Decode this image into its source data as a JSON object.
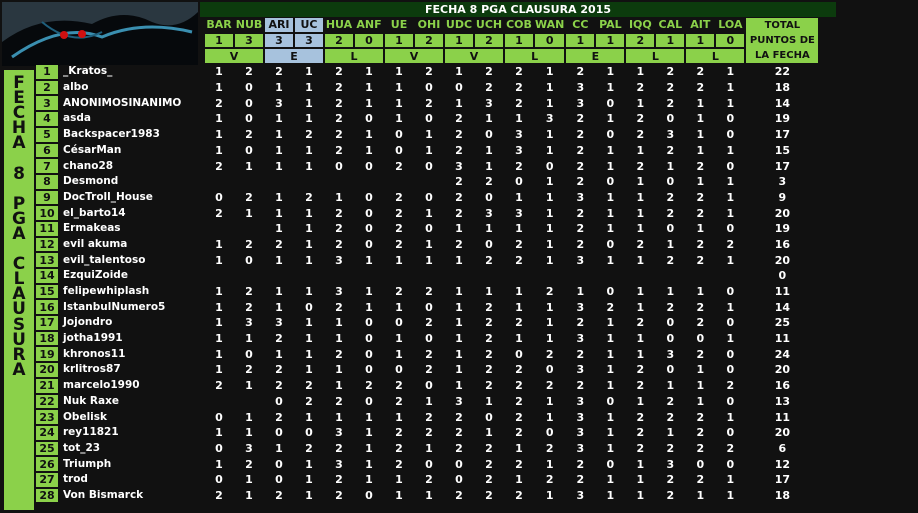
{
  "title": "FECHA 8 PGA CLAUSURA 2015",
  "side_label": [
    "F",
    "E",
    "C",
    "H",
    "A",
    "",
    "8",
    "",
    "P",
    "G",
    "A",
    "",
    "C",
    "L",
    "A",
    "U",
    "S",
    "U",
    "R",
    "A"
  ],
  "teams": [
    {
      "code": "BAR",
      "score": "1",
      "highlight": false
    },
    {
      "code": "NUB",
      "score": "3",
      "highlight": false
    },
    {
      "code": "ARI",
      "score": "3",
      "highlight": true
    },
    {
      "code": "UC",
      "score": "3",
      "highlight": true
    },
    {
      "code": "HUA",
      "score": "2",
      "highlight": false
    },
    {
      "code": "ANF",
      "score": "0",
      "highlight": false
    },
    {
      "code": "UE",
      "score": "1",
      "highlight": false
    },
    {
      "code": "OHI",
      "score": "2",
      "highlight": false
    },
    {
      "code": "UDC",
      "score": "1",
      "highlight": false
    },
    {
      "code": "UCH",
      "score": "2",
      "highlight": false
    },
    {
      "code": "COB",
      "score": "1",
      "highlight": false
    },
    {
      "code": "WAN",
      "score": "0",
      "highlight": false
    },
    {
      "code": "CC",
      "score": "1",
      "highlight": false
    },
    {
      "code": "PAL",
      "score": "1",
      "highlight": false
    },
    {
      "code": "IQQ",
      "score": "2",
      "highlight": false
    },
    {
      "code": "CAL",
      "score": "1",
      "highlight": false
    },
    {
      "code": "AIT",
      "score": "1",
      "highlight": false
    },
    {
      "code": "LOA",
      "score": "0",
      "highlight": false
    }
  ],
  "outcomes": [
    {
      "label": "V",
      "highlight": false
    },
    {
      "label": "E",
      "highlight": true
    },
    {
      "label": "L",
      "highlight": false
    },
    {
      "label": "V",
      "highlight": false
    },
    {
      "label": "V",
      "highlight": false
    },
    {
      "label": "L",
      "highlight": false
    },
    {
      "label": "E",
      "highlight": false
    },
    {
      "label": "L",
      "highlight": false
    },
    {
      "label": "L",
      "highlight": false
    }
  ],
  "total_header": [
    "TOTAL",
    "PUNTOS DE",
    "LA FECHA"
  ],
  "rows": [
    {
      "n": "1",
      "name": "_Kratos_",
      "v": [
        "1",
        "2",
        "2",
        "1",
        "2",
        "1",
        "1",
        "2",
        "1",
        "2",
        "2",
        "1",
        "2",
        "1",
        "1",
        "2",
        "2",
        "1"
      ],
      "total": "22"
    },
    {
      "n": "2",
      "name": "albo",
      "v": [
        "1",
        "0",
        "1",
        "1",
        "2",
        "1",
        "1",
        "0",
        "0",
        "2",
        "2",
        "1",
        "3",
        "1",
        "2",
        "2",
        "2",
        "1"
      ],
      "total": "18"
    },
    {
      "n": "3",
      "name": "ANONIMOSINANIMO",
      "v": [
        "2",
        "0",
        "3",
        "1",
        "2",
        "1",
        "1",
        "2",
        "1",
        "3",
        "2",
        "1",
        "3",
        "0",
        "1",
        "2",
        "1",
        "1"
      ],
      "total": "14"
    },
    {
      "n": "4",
      "name": "asda",
      "v": [
        "1",
        "0",
        "1",
        "1",
        "2",
        "0",
        "1",
        "0",
        "2",
        "1",
        "1",
        "3",
        "2",
        "1",
        "2",
        "0",
        "1",
        "0"
      ],
      "total": "19"
    },
    {
      "n": "5",
      "name": "Backspacer1983",
      "v": [
        "1",
        "2",
        "1",
        "2",
        "2",
        "1",
        "0",
        "1",
        "2",
        "0",
        "3",
        "1",
        "2",
        "0",
        "2",
        "3",
        "1",
        "0"
      ],
      "total": "17"
    },
    {
      "n": "6",
      "name": "CésarMan",
      "v": [
        "1",
        "0",
        "1",
        "1",
        "2",
        "1",
        "0",
        "1",
        "2",
        "1",
        "3",
        "1",
        "2",
        "1",
        "1",
        "2",
        "1",
        "1"
      ],
      "total": "15"
    },
    {
      "n": "7",
      "name": "chano28",
      "v": [
        "2",
        "1",
        "1",
        "1",
        "0",
        "0",
        "2",
        "0",
        "3",
        "1",
        "2",
        "0",
        "2",
        "1",
        "2",
        "1",
        "2",
        "0"
      ],
      "total": "17"
    },
    {
      "n": "8",
      "name": "Desmond",
      "v": [
        "",
        "",
        "",
        "",
        "",
        "",
        "",
        "",
        "2",
        "2",
        "0",
        "1",
        "2",
        "0",
        "1",
        "0",
        "1",
        "1"
      ],
      "total": "3"
    },
    {
      "n": "9",
      "name": "DocTroll_House",
      "v": [
        "0",
        "2",
        "1",
        "2",
        "1",
        "0",
        "2",
        "0",
        "2",
        "0",
        "1",
        "1",
        "3",
        "1",
        "1",
        "2",
        "2",
        "1"
      ],
      "total": "9"
    },
    {
      "n": "10",
      "name": "el_barto14",
      "v": [
        "2",
        "1",
        "1",
        "1",
        "2",
        "0",
        "2",
        "1",
        "2",
        "3",
        "3",
        "1",
        "2",
        "1",
        "1",
        "2",
        "2",
        "1"
      ],
      "total": "20"
    },
    {
      "n": "11",
      "name": "Ermakeas",
      "v": [
        "",
        "",
        "1",
        "1",
        "2",
        "0",
        "2",
        "0",
        "1",
        "1",
        "1",
        "1",
        "2",
        "1",
        "1",
        "0",
        "1",
        "0"
      ],
      "total": "19"
    },
    {
      "n": "12",
      "name": "evil akuma",
      "v": [
        "1",
        "2",
        "2",
        "1",
        "2",
        "0",
        "2",
        "1",
        "2",
        "0",
        "2",
        "1",
        "2",
        "0",
        "2",
        "1",
        "2",
        "2"
      ],
      "total": "16"
    },
    {
      "n": "13",
      "name": "evil_talentoso",
      "v": [
        "1",
        "0",
        "1",
        "1",
        "3",
        "1",
        "1",
        "1",
        "1",
        "2",
        "2",
        "1",
        "3",
        "1",
        "1",
        "2",
        "2",
        "1"
      ],
      "total": "20"
    },
    {
      "n": "14",
      "name": "EzquiZoide",
      "v": [
        "",
        "",
        "",
        "",
        "",
        "",
        "",
        "",
        "",
        "",
        "",
        "",
        "",
        "",
        "",
        "",
        "",
        ""
      ],
      "total": "0"
    },
    {
      "n": "15",
      "name": "felipewhiplash",
      "v": [
        "1",
        "2",
        "1",
        "1",
        "3",
        "1",
        "2",
        "2",
        "1",
        "1",
        "1",
        "2",
        "1",
        "0",
        "1",
        "1",
        "1",
        "0"
      ],
      "total": "11"
    },
    {
      "n": "16",
      "name": "IstanbulNumero5",
      "v": [
        "1",
        "2",
        "1",
        "0",
        "2",
        "1",
        "1",
        "0",
        "1",
        "2",
        "1",
        "1",
        "3",
        "2",
        "1",
        "2",
        "2",
        "1"
      ],
      "total": "14"
    },
    {
      "n": "17",
      "name": "Jojondro",
      "v": [
        "1",
        "3",
        "3",
        "1",
        "1",
        "0",
        "0",
        "2",
        "1",
        "2",
        "2",
        "1",
        "2",
        "1",
        "2",
        "0",
        "2",
        "0"
      ],
      "total": "25"
    },
    {
      "n": "18",
      "name": "jotha1991",
      "v": [
        "1",
        "1",
        "2",
        "1",
        "1",
        "0",
        "1",
        "0",
        "1",
        "2",
        "1",
        "1",
        "3",
        "1",
        "1",
        "0",
        "0",
        "1"
      ],
      "total": "11"
    },
    {
      "n": "19",
      "name": "khronos11",
      "v": [
        "1",
        "0",
        "1",
        "1",
        "2",
        "0",
        "1",
        "2",
        "1",
        "2",
        "0",
        "2",
        "2",
        "1",
        "1",
        "3",
        "2",
        "0"
      ],
      "total": "24"
    },
    {
      "n": "20",
      "name": "krlitros87",
      "v": [
        "1",
        "2",
        "2",
        "1",
        "1",
        "0",
        "0",
        "2",
        "1",
        "2",
        "2",
        "0",
        "3",
        "1",
        "2",
        "0",
        "1",
        "0"
      ],
      "total": "20"
    },
    {
      "n": "21",
      "name": "marcelo1990",
      "v": [
        "2",
        "1",
        "2",
        "2",
        "1",
        "2",
        "2",
        "0",
        "1",
        "2",
        "2",
        "2",
        "2",
        "1",
        "2",
        "1",
        "1",
        "2"
      ],
      "total": "16"
    },
    {
      "n": "22",
      "name": "Nuk Raxe",
      "v": [
        "",
        "",
        "0",
        "2",
        "2",
        "0",
        "2",
        "1",
        "3",
        "1",
        "2",
        "1",
        "3",
        "0",
        "1",
        "2",
        "1",
        "0"
      ],
      "total": "13"
    },
    {
      "n": "23",
      "name": "Obelisk",
      "v": [
        "0",
        "1",
        "2",
        "1",
        "1",
        "1",
        "1",
        "2",
        "2",
        "0",
        "2",
        "1",
        "3",
        "1",
        "2",
        "2",
        "2",
        "1"
      ],
      "total": "11"
    },
    {
      "n": "24",
      "name": "rey11821",
      "v": [
        "1",
        "1",
        "0",
        "0",
        "3",
        "1",
        "2",
        "2",
        "2",
        "1",
        "2",
        "0",
        "3",
        "1",
        "2",
        "1",
        "2",
        "0"
      ],
      "total": "20"
    },
    {
      "n": "25",
      "name": "tot_23",
      "v": [
        "0",
        "3",
        "1",
        "2",
        "2",
        "1",
        "2",
        "1",
        "2",
        "2",
        "1",
        "2",
        "3",
        "1",
        "2",
        "2",
        "2",
        "2"
      ],
      "total": "6"
    },
    {
      "n": "26",
      "name": "Triumph",
      "v": [
        "1",
        "2",
        "0",
        "1",
        "3",
        "1",
        "2",
        "0",
        "0",
        "2",
        "2",
        "1",
        "2",
        "0",
        "1",
        "3",
        "0",
        "0"
      ],
      "total": "12"
    },
    {
      "n": "27",
      "name": "trod",
      "v": [
        "0",
        "1",
        "0",
        "1",
        "2",
        "1",
        "1",
        "2",
        "0",
        "2",
        "1",
        "2",
        "2",
        "1",
        "1",
        "2",
        "2",
        "1"
      ],
      "total": "17"
    },
    {
      "n": "28",
      "name": "Von Bismarck",
      "v": [
        "2",
        "1",
        "2",
        "1",
        "2",
        "0",
        "1",
        "1",
        "2",
        "2",
        "2",
        "1",
        "3",
        "1",
        "1",
        "2",
        "1",
        "1"
      ],
      "total": "18"
    }
  ],
  "colors": {
    "accent": "#8bd14a",
    "highlight": "#a7c2dd",
    "dark": "#111111",
    "title_bg": "#0c3b0d"
  }
}
